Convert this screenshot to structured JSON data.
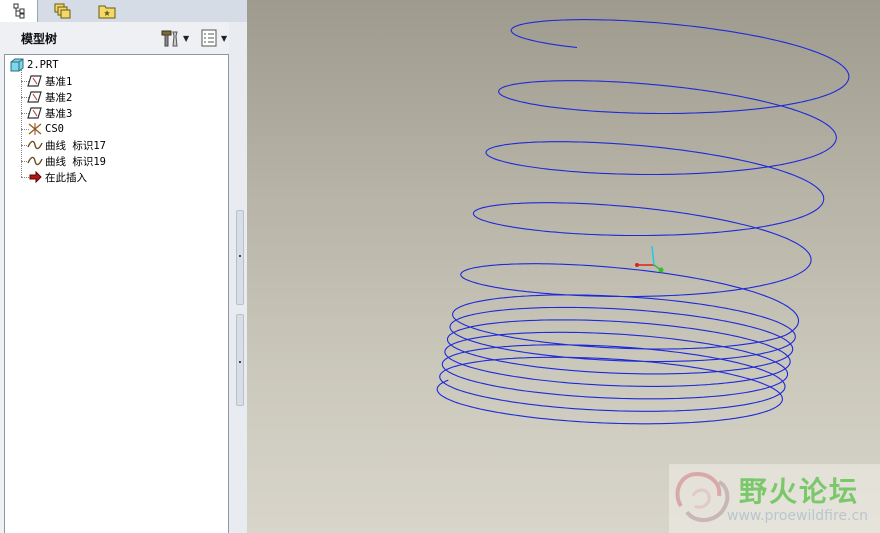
{
  "tabs": [
    {
      "id": "model-tree",
      "icon": "model-tree-icon",
      "active": true
    },
    {
      "id": "layers",
      "icon": "layers-icon",
      "active": false
    },
    {
      "id": "favorites",
      "icon": "favorites-folder-icon",
      "active": false
    }
  ],
  "tree_header": {
    "title": "模型树",
    "settings_icon": "tree-settings-icon",
    "columns_icon": "tree-columns-icon"
  },
  "tree": {
    "root": {
      "label": "2.PRT",
      "icon": "part-icon"
    },
    "items": [
      {
        "label": "基准1",
        "icon": "datum-plane-icon"
      },
      {
        "label": "基准2",
        "icon": "datum-plane-icon"
      },
      {
        "label": "基准3",
        "icon": "datum-plane-icon"
      },
      {
        "label": "CS0",
        "icon": "coordinate-system-icon"
      },
      {
        "label": "曲线 标识17",
        "icon": "curve-icon"
      },
      {
        "label": "曲线 标识19",
        "icon": "curve-icon"
      },
      {
        "label": "在此插入",
        "icon": "insert-here-arrow-icon"
      }
    ]
  },
  "colors": {
    "helix": "#1e2ad8",
    "graphics_top": "#9e9b8e",
    "graphics_bottom": "#d8d5ca",
    "watermark_green": "#7bc86c"
  },
  "watermark": {
    "title": "野火论坛",
    "url": "www.proewildfire.cn"
  }
}
